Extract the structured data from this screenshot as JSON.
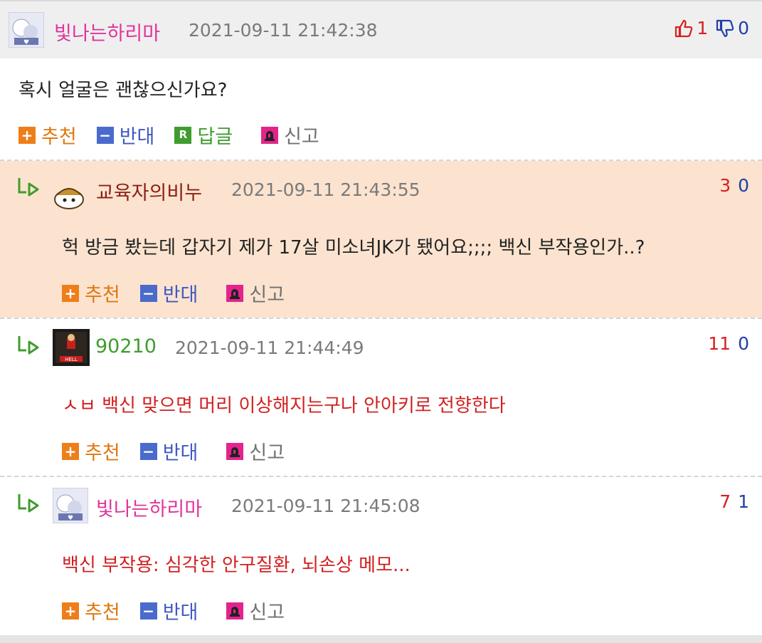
{
  "comments": [
    {
      "nickname": "빛나는하리마",
      "nickname_color": "#e0359a",
      "date": "2021-09-11 21:42:38",
      "up": "1",
      "down": "0",
      "text": "혹시 얼굴은 괜찮으신가요?",
      "text_color": "#222222",
      "actions": {
        "up": "추천",
        "down": "반대",
        "reply": "답글",
        "report": "신고"
      }
    },
    {
      "nickname": "교육자의비누",
      "nickname_color": "#8a1f14",
      "date": "2021-09-11 21:43:55",
      "up": "3",
      "down": "0",
      "text": "헉 방금 봤는데 갑자기 제가 17살 미소녀JK가 됐어요;;;; 백신 부작용인가..?",
      "text_color": "#222222",
      "actions": {
        "up": "추천",
        "down": "반대",
        "report": "신고"
      }
    },
    {
      "nickname": "90210",
      "nickname_color": "#3f9c2e",
      "date": "2021-09-11 21:44:49",
      "up": "11",
      "down": "0",
      "text": "ㅅㅂ 백신 맞으면 머리 이상해지는구나 안아키로 전향한다",
      "text_color": "#d22020",
      "actions": {
        "up": "추천",
        "down": "반대",
        "report": "신고"
      }
    },
    {
      "nickname": "빛나는하리마",
      "nickname_color": "#e0359a",
      "date": "2021-09-11 21:45:08",
      "up": "7",
      "down": "1",
      "text": "백신 부작용: 심각한 안구질환, 뇌손상 메모...",
      "text_color": "#d22020",
      "actions": {
        "up": "추천",
        "down": "반대",
        "report": "신고"
      }
    }
  ],
  "icons": {
    "reply_arrow": "reply-arrow-icon",
    "thumbs_up": "thumbs-up-icon",
    "thumbs_down": "thumbs-down-icon",
    "plus": "plus-icon",
    "minus": "minus-icon",
    "reply_badge": "reply-r-icon",
    "report": "siren-icon"
  },
  "colors": {
    "highlight_bg": "#fbe3cf",
    "header_bg": "#efefef",
    "up_count": "#d62020",
    "down_count": "#1f3fa8"
  }
}
